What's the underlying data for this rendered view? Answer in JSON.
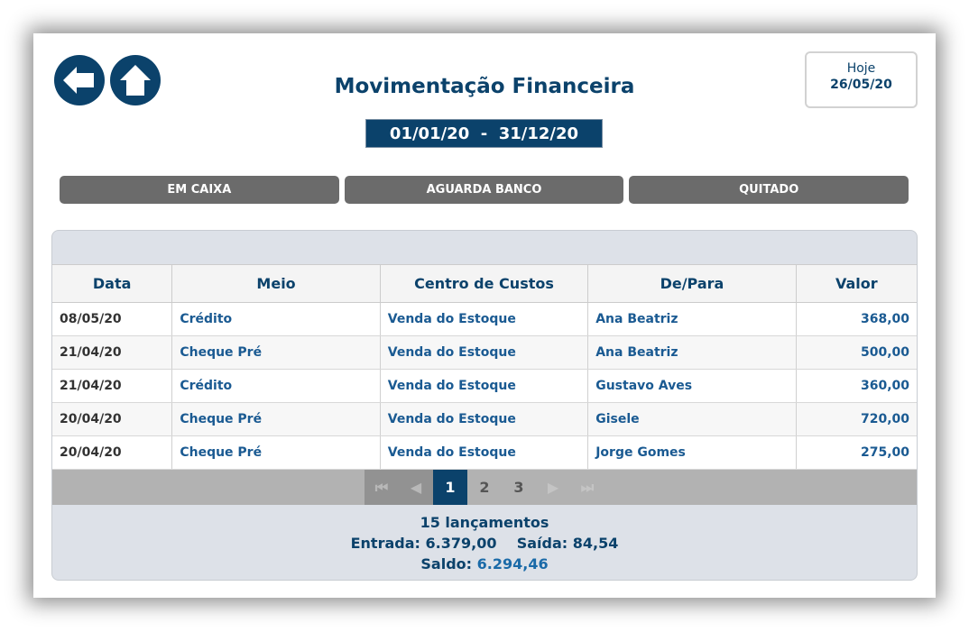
{
  "header": {
    "title": "Movimentação Financeira",
    "date_range": "01/01/20  -  31/12/20",
    "today_label": "Hoje",
    "today_value": "26/05/20"
  },
  "tabs": [
    {
      "label": "EM CAIXA"
    },
    {
      "label": "AGUARDA BANCO"
    },
    {
      "label": "QUITADO"
    }
  ],
  "table": {
    "columns": [
      "Data",
      "Meio",
      "Centro de Custos",
      "De/Para",
      "Valor"
    ],
    "rows": [
      [
        "08/05/20",
        "Crédito",
        "Venda do Estoque",
        "Ana Beatriz",
        "368,00"
      ],
      [
        "21/04/20",
        "Cheque Pré",
        "Venda do Estoque",
        "Ana Beatriz",
        "500,00"
      ],
      [
        "21/04/20",
        "Crédito",
        "Venda do Estoque",
        "Gustavo Aves",
        "360,00"
      ],
      [
        "20/04/20",
        "Cheque Pré",
        "Venda do Estoque",
        "Gisele",
        "720,00"
      ],
      [
        "20/04/20",
        "Cheque Pré",
        "Venda do Estoque",
        "Jorge Gomes",
        "275,00"
      ]
    ]
  },
  "pager": {
    "pages": [
      "1",
      "2",
      "3"
    ],
    "current": "1",
    "first": "⏮",
    "prev": "◀",
    "next": "▶",
    "last": "⏭"
  },
  "footer": {
    "count": "15 lançamentos",
    "entrada_label": "Entrada:",
    "entrada": "6.379,00",
    "saida_label": "Saída:",
    "saida": "84,54",
    "saldo_label": "Saldo:",
    "saldo": "6.294,46"
  },
  "colors": {
    "primary": "#0b426b",
    "tab": "#6b6b6b"
  }
}
